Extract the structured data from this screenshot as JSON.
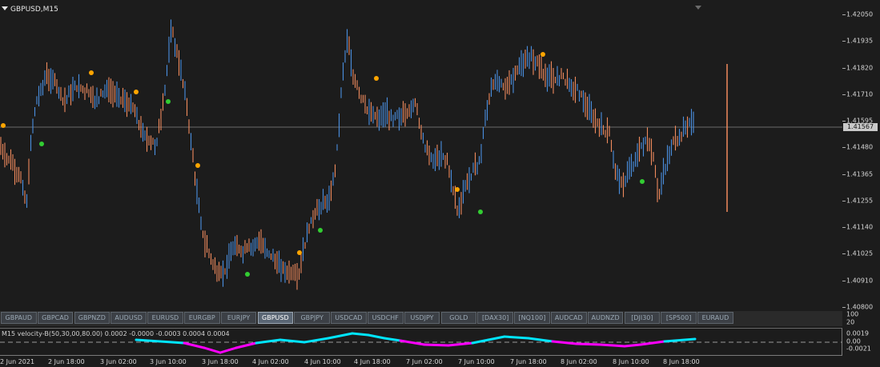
{
  "chart": {
    "symbol_title": "GBPUSD,M15",
    "price_axis_labels": [
      "1.42050",
      "1.41935",
      "1.41820",
      "1.41710",
      "1.41595",
      "1.41480",
      "1.41365",
      "1.41255",
      "1.41140",
      "1.41025",
      "1.40910",
      "1.40800"
    ],
    "current_price": "1.41567",
    "colors": {
      "up_bar": "#4a8fe0",
      "down_bar": "#f08a5d",
      "signal_sell": "#ffa500",
      "signal_buy": "#32cd32",
      "grid_price_line": "#6a6a6a"
    }
  },
  "symbol_tabs": [
    {
      "label": "GBPAUD",
      "active": false
    },
    {
      "label": "GBPCAD",
      "active": false
    },
    {
      "label": "GBPNZD",
      "active": false
    },
    {
      "label": "AUDUSD",
      "active": false
    },
    {
      "label": "EURUSD",
      "active": false
    },
    {
      "label": "EURGBP",
      "active": false
    },
    {
      "label": "EURJPY",
      "active": false
    },
    {
      "label": "GBPUSD",
      "active": true
    },
    {
      "label": "GBPJPY",
      "active": false
    },
    {
      "label": "USDCAD",
      "active": false
    },
    {
      "label": "USDCHF",
      "active": false
    },
    {
      "label": "USDJPY",
      "active": false
    },
    {
      "label": "GOLD",
      "active": false
    },
    {
      "label": "[DAX30]",
      "active": false
    },
    {
      "label": "[NQ100]",
      "active": false
    },
    {
      "label": "AUDCAD",
      "active": false
    },
    {
      "label": "AUDNZD",
      "active": false
    },
    {
      "label": "[DJI30]",
      "active": false
    },
    {
      "label": "[SP500]",
      "active": false
    },
    {
      "label": "EURAUD",
      "active": false
    }
  ],
  "indicator": {
    "label": "M15 velocity-B(50,30,00,80.00) 0.0002 -0.0000 -0.0003 0.0004 0.0004",
    "axis_labels": [
      "100",
      "20",
      "0.0019",
      "0.00",
      "-0.0021"
    ],
    "colors": {
      "positive": "#00e5ff",
      "negative": "#ff00ff"
    }
  },
  "time_axis": {
    "labels": [
      "2 Jun 2021",
      "2 Jun 18:00",
      "3 Jun 02:00",
      "3 Jun 10:00",
      "3 Jun 18:00",
      "4 Jun 02:00",
      "4 Jun 10:00",
      "4 Jun 18:00",
      "7 Jun 02:00",
      "7 Jun 10:00",
      "7 Jun 18:00",
      "8 Jun 02:00",
      "8 Jun 10:00",
      "8 Jun 18:00"
    ]
  }
}
